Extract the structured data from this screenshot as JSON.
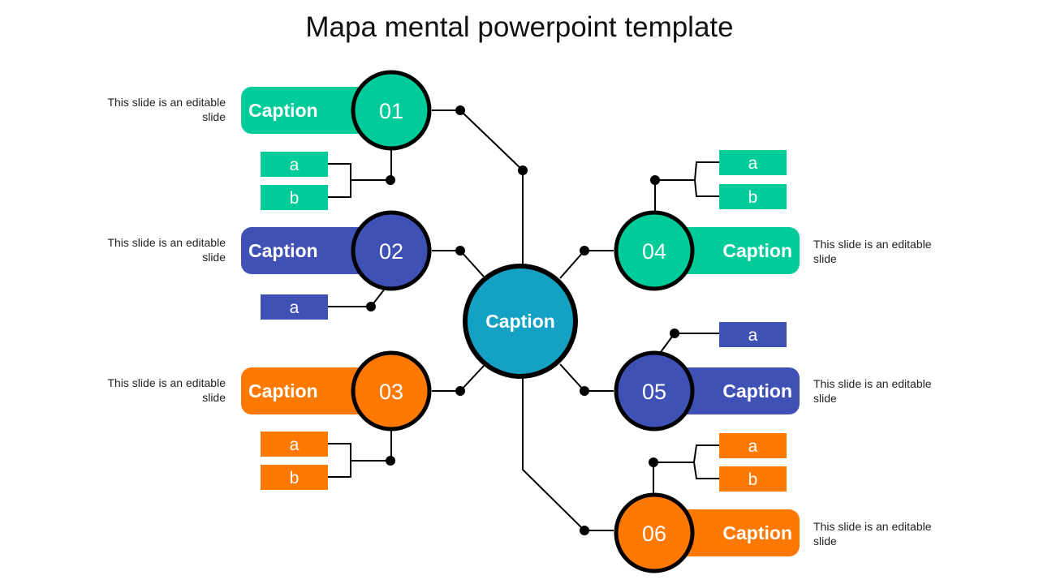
{
  "title": "Mapa mental powerpoint template",
  "colors": {
    "green": "#00CC99",
    "blue": "#4051B5",
    "orange": "#FF7800",
    "center": "#14A1C4",
    "outline": "#000000"
  },
  "center": {
    "label": "Caption"
  },
  "nodes": [
    {
      "number": "01",
      "caption": "Caption",
      "color": "green",
      "description": "This slide is an editable slide",
      "tags": [
        "a",
        "b"
      ]
    },
    {
      "number": "02",
      "caption": "Caption",
      "color": "blue",
      "description": "This slide is an editable slide",
      "tags": [
        "a"
      ]
    },
    {
      "number": "03",
      "caption": "Caption",
      "color": "orange",
      "description": "This slide is an editable slide",
      "tags": [
        "a",
        "b"
      ]
    },
    {
      "number": "04",
      "caption": "Caption",
      "color": "green",
      "description": "This slide is an editable slide",
      "tags": [
        "a",
        "b"
      ]
    },
    {
      "number": "05",
      "caption": "Caption",
      "color": "blue",
      "description": "This slide is an editable slide",
      "tags": [
        "a"
      ]
    },
    {
      "number": "06",
      "caption": "Caption",
      "color": "orange",
      "description": "This slide is an editable slide",
      "tags": [
        "a",
        "b"
      ]
    }
  ]
}
